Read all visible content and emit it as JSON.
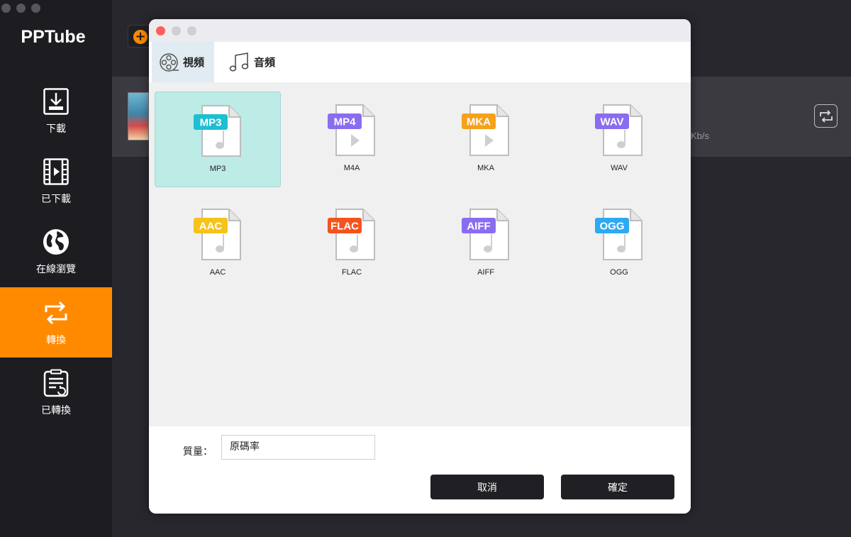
{
  "app": {
    "title": "PPTube"
  },
  "sidebar": {
    "items": [
      {
        "label": "下載",
        "icon": "download-icon"
      },
      {
        "label": "已下載",
        "icon": "video-film-icon"
      },
      {
        "label": "在線瀏覽",
        "icon": "globe-icon"
      },
      {
        "label": "轉換",
        "icon": "convert-arrows-icon",
        "active": true
      },
      {
        "label": "已轉換",
        "icon": "converted-list-icon"
      }
    ]
  },
  "background": {
    "speed_text": "Kb/s"
  },
  "dialog": {
    "tabs": [
      {
        "label": "視頻",
        "icon": "film-reel-icon"
      },
      {
        "label": "音頻",
        "icon": "music-note-icon"
      }
    ],
    "formats": [
      {
        "badge": "MP3",
        "label": "MP3",
        "color": "#1ebfd2",
        "glyph": "note",
        "selected": true
      },
      {
        "badge": "MP4",
        "label": "M4A",
        "color": "#8a6cf0",
        "glyph": "play"
      },
      {
        "badge": "MKA",
        "label": "MKA",
        "color": "#f5a11c",
        "glyph": "play"
      },
      {
        "badge": "WAV",
        "label": "WAV",
        "color": "#8a6cf0",
        "glyph": "note"
      },
      {
        "badge": "AAC",
        "label": "AAC",
        "color": "#f6c21b",
        "glyph": "note"
      },
      {
        "badge": "FLAC",
        "label": "FLAC",
        "color": "#f5531e",
        "glyph": "note"
      },
      {
        "badge": "AIFF",
        "label": "AIFF",
        "color": "#8a6cf0",
        "glyph": "note"
      },
      {
        "badge": "OGG",
        "label": "OGG",
        "color": "#2ea9f2",
        "glyph": "note"
      }
    ],
    "quality": {
      "label": "質量：",
      "value": "原碼率"
    },
    "buttons": {
      "cancel": "取消",
      "ok": "確定"
    }
  },
  "colors": {
    "accent": "#ff8a00",
    "selected_card": "#bdebe6",
    "sidebar_bg": "#1c1c21"
  }
}
